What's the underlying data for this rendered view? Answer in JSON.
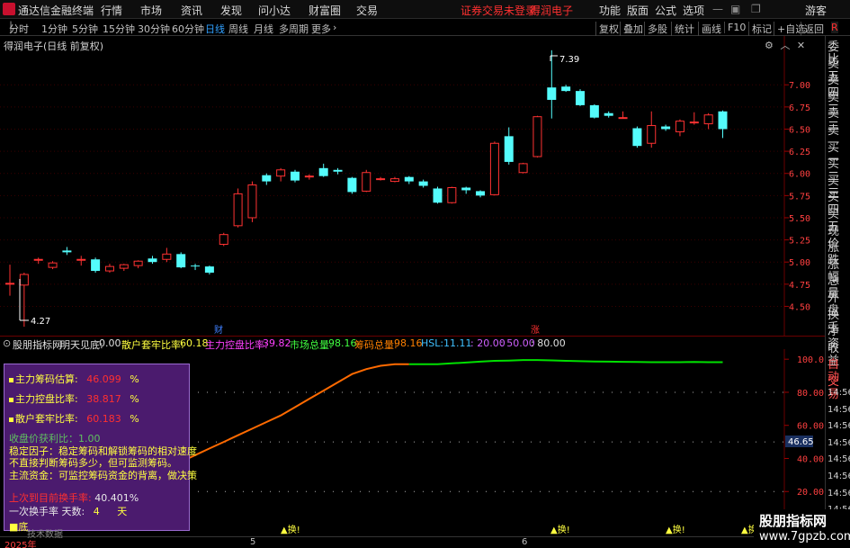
{
  "menubar": {
    "app_title": "通达信金融终端",
    "items": [
      "行情",
      "市场",
      "资讯",
      "发现",
      "问小达",
      "财富圈",
      "交易"
    ],
    "status_warning": "证券交易未登录",
    "stock_name": "得润电子",
    "right_items": [
      "功能",
      "版面",
      "公式",
      "选项"
    ],
    "guest": "游客"
  },
  "toolbar": {
    "periods": [
      "分时",
      "1分钟",
      "5分钟",
      "15分钟",
      "30分钟",
      "60分钟",
      "日线",
      "周线",
      "月线",
      "多周期",
      "更多"
    ],
    "active_period": "日线",
    "buttons": [
      "复权",
      "叠加",
      "多股",
      "统计",
      "画线",
      "F10",
      "标记",
      "+自选",
      "返回"
    ],
    "r_label": "R"
  },
  "chart_header": {
    "title": "得润电子(日线 前复权)"
  },
  "price_axis": {
    "ticks": [
      "7.00",
      "6.75",
      "6.50",
      "6.25",
      "6.00",
      "5.75",
      "5.50",
      "5.25",
      "5.00",
      "4.75",
      "4.50"
    ]
  },
  "annotations": {
    "high": "7.39",
    "low": "4.27",
    "event1": "财",
    "event2": "涨"
  },
  "chart_data": {
    "type": "candlestick",
    "ylim": [
      4.2,
      7.5
    ],
    "candles": [
      {
        "o": 4.76,
        "c": 4.76,
        "h": 4.97,
        "l": 4.62
      },
      {
        "o": 4.74,
        "c": 4.86,
        "h": 4.88,
        "l": 4.27
      },
      {
        "o": 5.03,
        "c": 5.03,
        "h": 5.05,
        "l": 4.98
      },
      {
        "o": 4.94,
        "c": 4.99,
        "h": 5.01,
        "l": 4.92
      },
      {
        "o": 5.13,
        "c": 5.11,
        "h": 5.17,
        "l": 5.08
      },
      {
        "o": 5.02,
        "c": 5.03,
        "h": 5.07,
        "l": 4.96
      },
      {
        "o": 5.03,
        "c": 4.9,
        "h": 5.05,
        "l": 4.88
      },
      {
        "o": 4.9,
        "c": 4.95,
        "h": 4.98,
        "l": 4.88
      },
      {
        "o": 4.93,
        "c": 4.97,
        "h": 4.98,
        "l": 4.9
      },
      {
        "o": 4.96,
        "c": 5.01,
        "h": 5.02,
        "l": 4.93
      },
      {
        "o": 5.04,
        "c": 5.0,
        "h": 5.07,
        "l": 4.98
      },
      {
        "o": 5.03,
        "c": 5.09,
        "h": 5.16,
        "l": 5.0
      },
      {
        "o": 5.09,
        "c": 4.94,
        "h": 5.11,
        "l": 4.93
      },
      {
        "o": 4.96,
        "c": 4.95,
        "h": 4.98,
        "l": 4.91
      },
      {
        "o": 4.95,
        "c": 4.88,
        "h": 4.96,
        "l": 4.86
      },
      {
        "o": 5.2,
        "c": 5.31,
        "h": 5.33,
        "l": 5.18
      },
      {
        "o": 5.41,
        "c": 5.77,
        "h": 5.83,
        "l": 5.39
      },
      {
        "o": 5.5,
        "c": 5.87,
        "h": 5.91,
        "l": 5.45
      },
      {
        "o": 5.98,
        "c": 5.91,
        "h": 6.0,
        "l": 5.87
      },
      {
        "o": 5.97,
        "c": 6.04,
        "h": 6.06,
        "l": 5.91
      },
      {
        "o": 6.02,
        "c": 5.92,
        "h": 6.04,
        "l": 5.9
      },
      {
        "o": 5.97,
        "c": 5.97,
        "h": 5.99,
        "l": 5.93
      },
      {
        "o": 6.06,
        "c": 5.97,
        "h": 6.11,
        "l": 5.96
      },
      {
        "o": 6.04,
        "c": 6.02,
        "h": 6.06,
        "l": 5.99
      },
      {
        "o": 5.95,
        "c": 5.79,
        "h": 5.96,
        "l": 5.77
      },
      {
        "o": 5.8,
        "c": 6.01,
        "h": 6.04,
        "l": 5.79
      },
      {
        "o": 5.94,
        "c": 5.94,
        "h": 5.96,
        "l": 5.92
      },
      {
        "o": 5.91,
        "c": 5.94,
        "h": 5.96,
        "l": 5.9
      },
      {
        "o": 5.96,
        "c": 5.91,
        "h": 5.97,
        "l": 5.88
      },
      {
        "o": 5.91,
        "c": 5.86,
        "h": 5.93,
        "l": 5.84
      },
      {
        "o": 5.83,
        "c": 5.67,
        "h": 5.85,
        "l": 5.66
      },
      {
        "o": 5.67,
        "c": 5.84,
        "h": 5.85,
        "l": 5.66
      },
      {
        "o": 5.84,
        "c": 5.81,
        "h": 5.85,
        "l": 5.77
      },
      {
        "o": 5.8,
        "c": 5.75,
        "h": 5.81,
        "l": 5.73
      },
      {
        "o": 5.76,
        "c": 6.34,
        "h": 6.36,
        "l": 5.75
      },
      {
        "o": 6.42,
        "c": 6.13,
        "h": 6.52,
        "l": 6.1
      },
      {
        "o": 6.01,
        "c": 6.11,
        "h": 6.12,
        "l": 6.0
      },
      {
        "o": 6.19,
        "c": 6.64,
        "h": 6.65,
        "l": 6.18
      },
      {
        "o": 6.97,
        "c": 6.83,
        "h": 7.39,
        "l": 6.62
      },
      {
        "o": 6.98,
        "c": 6.93,
        "h": 7.0,
        "l": 6.92
      },
      {
        "o": 6.93,
        "c": 6.77,
        "h": 6.95,
        "l": 6.76
      },
      {
        "o": 6.77,
        "c": 6.63,
        "h": 6.78,
        "l": 6.62
      },
      {
        "o": 6.68,
        "c": 6.65,
        "h": 6.7,
        "l": 6.63
      },
      {
        "o": 6.63,
        "c": 6.63,
        "h": 6.7,
        "l": 6.62
      },
      {
        "o": 6.51,
        "c": 6.31,
        "h": 6.53,
        "l": 6.29
      },
      {
        "o": 6.34,
        "c": 6.54,
        "h": 6.7,
        "l": 6.29
      },
      {
        "o": 6.53,
        "c": 6.5,
        "h": 6.55,
        "l": 6.48
      },
      {
        "o": 6.47,
        "c": 6.59,
        "h": 6.61,
        "l": 6.42
      },
      {
        "o": 6.58,
        "c": 6.58,
        "h": 6.69,
        "l": 6.55
      },
      {
        "o": 6.56,
        "c": 6.66,
        "h": 6.68,
        "l": 6.5
      },
      {
        "o": 6.7,
        "c": 6.5,
        "h": 6.71,
        "l": 6.4
      }
    ]
  },
  "indicator_header": {
    "name": "股朋指标网",
    "f1_label": "明天见底:",
    "f1_value": "0.00",
    "f2_label": "散户套牢比率:",
    "f2_value": "60.18",
    "f3_label": "主力控盘比率:",
    "f3_value": "39.82",
    "f4_label": "市场总量:",
    "f4_value": "98.16",
    "f5_label": "筹码总量:",
    "f5_value": "98.16",
    "f6_label": "HSL:",
    "f6_value": "11.11",
    "f7_value": ": 20.00",
    "f8_value": ": 50.00",
    "f9_value": ": 80.00"
  },
  "indicator_axis": {
    "ticks": [
      "100.0",
      "80.00",
      "60.00",
      "40.00",
      "20.00"
    ],
    "current": "46.65"
  },
  "indicator_data": {
    "ylim": [
      0,
      105
    ],
    "values": [
      8,
      9,
      10,
      11,
      12,
      14,
      16,
      19,
      22,
      26,
      30,
      34,
      38,
      42,
      46,
      50,
      54,
      58,
      62,
      66,
      71,
      76,
      81,
      86,
      91,
      94,
      96,
      97,
      97,
      97,
      97,
      97.5,
      98,
      98.5,
      99,
      99.2,
      99.5,
      99.5,
      99.3,
      99,
      98.8,
      98.6,
      98.5,
      98.4,
      98.3,
      98.2,
      98.2,
      98.2,
      98.3,
      98.2,
      98.2
    ],
    "green_from_index": 28,
    "dashed_levels": [
      80,
      50,
      20
    ]
  },
  "ind_panel": {
    "row1_label": "主力筹码估算:",
    "row1_value": "46.099",
    "row1_unit": "%",
    "row2_label": "主力控盘比率:",
    "row2_value": "38.817",
    "row2_unit": "%",
    "row3_label": "散户套牢比率:",
    "row3_value": "60.183",
    "row3_unit": "%",
    "row4": "收盘价获利比：1.00",
    "row5": "稳定因子：稳定筹码和解锁筹码的相对速度",
    "row6": "不直接判断筹码多少，但可监测筹码。",
    "row7": "主流资金：可监控筹码资金的背离，做决策",
    "row8_label": "上次到目前换手率:",
    "row8_value": "40.40",
    "row8_unit": "1%",
    "row9_label": "一次换手率 天数:",
    "row9_value": "4",
    "row9_unit": "天",
    "row10": "■底"
  },
  "signals": {
    "label": "▲换!"
  },
  "bottom_axis": {
    "year": "2025年",
    "m5": "5",
    "m6": "6",
    "tech_label": "技术数据"
  },
  "quote_panel": {
    "items": [
      "委比",
      "卖五",
      "卖四",
      "卖三",
      "卖二",
      "卖一",
      "买一",
      "买二",
      "买三",
      "买四",
      "买五",
      "现价",
      "涨跌",
      "涨幅",
      "总量",
      "外盘",
      "换手",
      "净资",
      "收益",
      "自动",
      "交易",
      "14:56",
      "14:56",
      "14:56",
      "14:56",
      "14:56",
      "14:56",
      "14:56",
      "14:56",
      "14:56",
      "14:56"
    ]
  },
  "watermark": {
    "line1": "股朋指标网",
    "line2": "www.7gpzb.com"
  },
  "colors": {
    "up": "#ff3232",
    "down": "#54fcfc",
    "indicator_line": "#ff6a00",
    "indicator_line2": "#00e000"
  }
}
